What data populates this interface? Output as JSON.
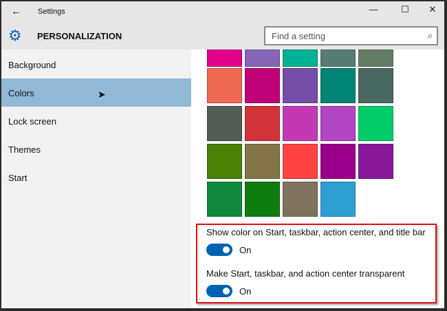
{
  "window": {
    "title": "Settings",
    "back_icon": "←",
    "minimize": "—",
    "maximize": "☐",
    "close": "✕"
  },
  "header": {
    "title": "PERSONALIZATION",
    "search_placeholder": "Find a setting",
    "search_icon": "⌕"
  },
  "sidebar": {
    "items": [
      {
        "label": "Background"
      },
      {
        "label": "Colors"
      },
      {
        "label": "Lock screen"
      },
      {
        "label": "Themes"
      },
      {
        "label": "Start"
      }
    ],
    "selected": "Colors"
  },
  "swatches": [
    [
      "#e3008c",
      "#8764b8",
      "#00b294",
      "#567c73",
      "#647c64"
    ],
    [
      "#ef6950",
      "#bf0077",
      "#744da9",
      "#018574",
      "#486860"
    ],
    [
      "#525e54",
      "#d13438",
      "#c239b3",
      "#b146c2",
      "#00cc6a"
    ],
    [
      "#498205",
      "#847545",
      "#ff4343",
      "#9a0089",
      "#881798"
    ],
    [
      "#10893e",
      "#107c10",
      "#7e735f",
      "#2d9fd0"
    ]
  ],
  "settings": [
    {
      "label": "Show color on Start, taskbar, action center, and title bar",
      "state": "On",
      "value": true
    },
    {
      "label": "Make Start, taskbar, and action center transparent",
      "state": "On",
      "value": true
    }
  ],
  "colors": {
    "accent": "#0063b1",
    "selected_nav": "#92b8d8",
    "highlight_box": "#e01010"
  }
}
